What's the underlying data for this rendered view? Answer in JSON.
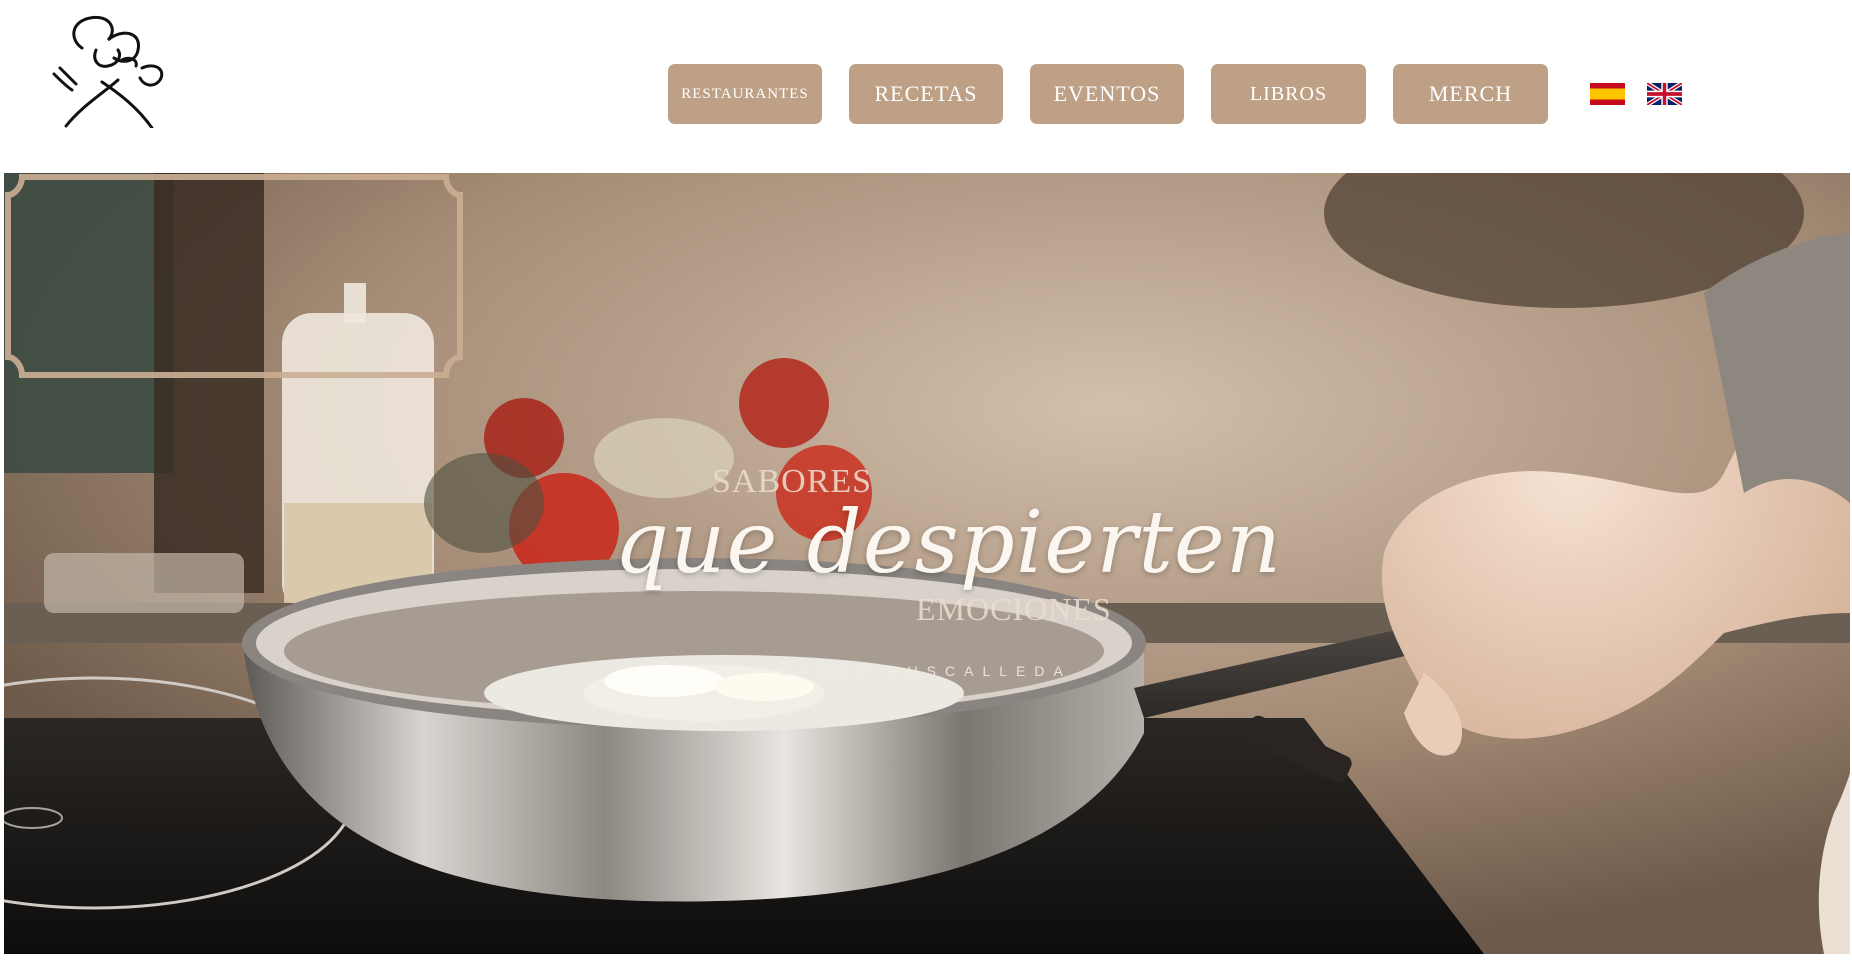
{
  "brand": {
    "logo_icon": "chef-hat-cutlery-logo-icon"
  },
  "nav": {
    "items": [
      {
        "label": "RESTAURANTES"
      },
      {
        "label": "RECETAS"
      },
      {
        "label": "EVENTOS"
      },
      {
        "label": "LIBROS"
      },
      {
        "label": "MERCH"
      }
    ],
    "button_color": "#bda085"
  },
  "languages": [
    {
      "icon": "spain-flag-icon"
    },
    {
      "icon": "uk-flag-icon"
    }
  ],
  "hero": {
    "line1": "SABORES",
    "line2": "que despierten",
    "line3": "EMOCIONES",
    "author": "CARME RUSCALLEDA",
    "frame_color": "#c9ae93"
  }
}
